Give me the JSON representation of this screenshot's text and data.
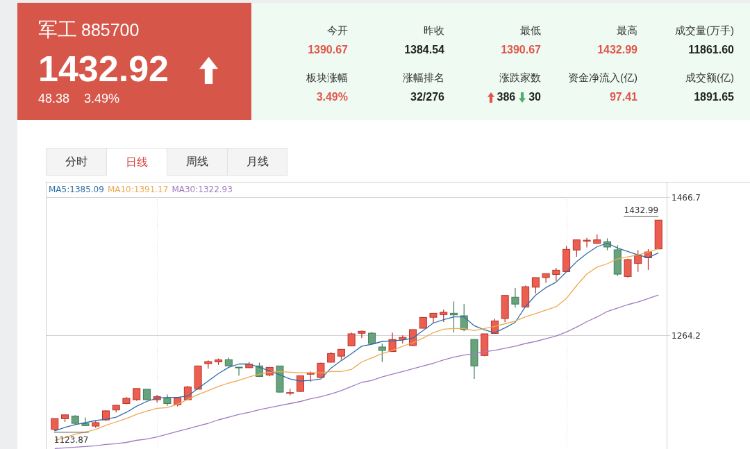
{
  "quote": {
    "name": "军工",
    "code": "885700",
    "price": "1432.92",
    "rising": true,
    "change": "48.38",
    "change_percent": "3.49%"
  },
  "stats": [
    {
      "label": "今开",
      "kind": "value",
      "value": "1390.67",
      "color": "#e0554b"
    },
    {
      "label": "昨收",
      "kind": "value",
      "value": "1384.54",
      "color": "#222222"
    },
    {
      "label": "最低",
      "kind": "value",
      "value": "1390.67",
      "color": "#e0554b"
    },
    {
      "label": "最高",
      "kind": "value",
      "value": "1432.99",
      "color": "#e0554b"
    },
    {
      "label": "成交量(万手)",
      "kind": "value",
      "value": "11861.60",
      "color": "#222222"
    },
    {
      "label": "板块涨幅",
      "kind": "value",
      "value": "3.49%",
      "color": "#e0554b"
    },
    {
      "label": "涨幅排名",
      "kind": "value",
      "value": "32/276",
      "color": "#222222"
    },
    {
      "label": "涨跌家数",
      "kind": "updown",
      "rise_count": "386",
      "fall_count": "30"
    },
    {
      "label": "资金净流入(亿)",
      "kind": "value",
      "value": "97.41",
      "color": "#e0554b"
    },
    {
      "label": "成交额(亿)",
      "kind": "value",
      "value": "1891.65",
      "color": "#222222"
    }
  ],
  "tabs": [
    {
      "label": "分时",
      "selected": false
    },
    {
      "label": "日线",
      "selected": true
    },
    {
      "label": "周线",
      "selected": false
    },
    {
      "label": "月线",
      "selected": false
    }
  ],
  "chart": {
    "chart_data": {
      "type": "candlestick",
      "grid": true,
      "ylim": [
        1097.3,
        1488.1
      ],
      "yticks": [
        {
          "value": 1466.7,
          "label": "1466.7"
        },
        {
          "value": 1264.2,
          "label": "1264.2"
        }
      ],
      "categories": [
        null,
        null,
        null,
        null,
        null,
        null,
        null,
        null,
        null,
        null,
        null,
        null,
        null,
        null,
        null,
        null,
        null,
        null,
        null,
        null,
        null,
        null,
        null,
        null,
        null,
        null,
        null,
        null,
        null,
        null,
        null,
        null,
        null,
        null,
        null,
        null,
        null,
        null,
        null,
        null,
        null,
        null,
        null,
        null,
        null,
        null,
        null,
        null,
        null,
        null,
        null,
        null,
        null,
        null,
        null,
        null,
        null,
        null,
        null,
        null
      ],
      "ohlc": [
        [
          1126,
          1142,
          1123.87,
          1142
        ],
        [
          1141.7,
          1147.4,
          1137,
          1147.4
        ],
        [
          1145.6,
          1147,
          1133,
          1134.9
        ],
        [
          1134.6,
          1143.6,
          1131,
          1131.6
        ],
        [
          1130.9,
          1138.6,
          1128.3,
          1136
        ],
        [
          1140,
          1154,
          1138,
          1153.3
        ],
        [
          1154.6,
          1161.4,
          1151,
          1161.4
        ],
        [
          1164,
          1173.6,
          1162.9,
          1171.6
        ],
        [
          1169.6,
          1186,
          1168,
          1186
        ],
        [
          1184.9,
          1185.5,
          1168.5,
          1169.6
        ],
        [
          1169.6,
          1176.7,
          1165.5,
          1174
        ],
        [
          1171.6,
          1177.3,
          1160.7,
          1164
        ],
        [
          1162.2,
          1172.6,
          1159.6,
          1172.6
        ],
        [
          1169.6,
          1189.8,
          1169,
          1188.2
        ],
        [
          1185,
          1219.1,
          1184.5,
          1219.1
        ],
        [
          1222.5,
          1227.3,
          1215,
          1225.5
        ],
        [
          1225,
          1230,
          1220.5,
          1228
        ],
        [
          1228.3,
          1231.4,
          1219.2,
          1219.2
        ],
        [
          1217.3,
          1217.3,
          1205,
          1217
        ],
        [
          1216.5,
          1225,
          1216,
          1221.5
        ],
        [
          1219.1,
          1224,
          1203,
          1203.7
        ],
        [
          1205.8,
          1217,
          1204,
          1217
        ],
        [
          1219.1,
          1219.1,
          1180,
          1180.7
        ],
        [
          1179,
          1185.5,
          1176,
          1180
        ],
        [
          1181.7,
          1204.6,
          1181,
          1204.6
        ],
        [
          1207,
          1211,
          1196,
          1208.8
        ],
        [
          1202.1,
          1224,
          1201.5,
          1223.1
        ],
        [
          1224.6,
          1239.5,
          1224,
          1237.3
        ],
        [
          1233.5,
          1243.5,
          1228.5,
          1243.5
        ],
        [
          1248.6,
          1268,
          1248,
          1266.2
        ],
        [
          1267,
          1271,
          1260,
          1270
        ],
        [
          1267.2,
          1269,
          1251,
          1252
        ],
        [
          1246.9,
          1252,
          1225,
          1241.8
        ],
        [
          1240.2,
          1268,
          1240,
          1257.9
        ],
        [
          1258,
          1264,
          1252,
          1261
        ],
        [
          1249,
          1272.4,
          1248,
          1272.4
        ],
        [
          1274.4,
          1290.3,
          1274,
          1290.3
        ],
        [
          1290.5,
          1296.4,
          1281.8,
          1296.4
        ],
        [
          1294.4,
          1301.8,
          1283.5,
          1297.8
        ],
        [
          1296.4,
          1313.7,
          1268,
          1294
        ],
        [
          1292.7,
          1309.8,
          1270,
          1272.4
        ],
        [
          1257.9,
          1258,
          1200,
          1219.1
        ],
        [
          1234.4,
          1266.2,
          1233.5,
          1266.2
        ],
        [
          1266.7,
          1288.6,
          1266,
          1285.1
        ],
        [
          1288.6,
          1322.5,
          1283.2,
          1322.5
        ],
        [
          1319.9,
          1333.4,
          1304.6,
          1309.8
        ],
        [
          1305.5,
          1337,
          1305,
          1335.3
        ],
        [
          1334.6,
          1348.7,
          1325.6,
          1348.7
        ],
        [
          1348.7,
          1354.5,
          1341,
          1354.5
        ],
        [
          1353.3,
          1363,
          1343.6,
          1359.5
        ],
        [
          1357.4,
          1395.2,
          1357,
          1390.1
        ],
        [
          1389.1,
          1404,
          1379.2,
          1404
        ],
        [
          1402,
          1407,
          1393,
          1403.5
        ],
        [
          1398.9,
          1412,
          1398,
          1404
        ],
        [
          1401.3,
          1406.2,
          1388.7,
          1393.5
        ],
        [
          1389.4,
          1396.2,
          1351,
          1353.7
        ],
        [
          1350.3,
          1376.5,
          1348.7,
          1375.1
        ],
        [
          1369.4,
          1389,
          1357,
          1381.3
        ],
        [
          1377.7,
          1390.4,
          1360,
          1386.3
        ],
        [
          1390.67,
          1432.99,
          1390.67,
          1432.92
        ]
      ],
      "series": [
        {
          "name": "MA5:1385.09",
          "type": "line",
          "color": "#2f6ea8",
          "values": [
            1124,
            1129,
            1133,
            1136,
            1139,
            1141,
            1144,
            1151,
            1160,
            1167,
            1172,
            1173,
            1173,
            1175,
            1186,
            1197,
            1208,
            1217,
            1222,
            1222,
            1217,
            1212,
            1206,
            1200,
            1197,
            1198,
            1200,
            1216,
            1227,
            1237,
            1248,
            1251,
            1255,
            1256,
            1257,
            1260,
            1271,
            1282,
            1287,
            1291,
            1291,
            1278,
            1272,
            1268,
            1275,
            1283,
            1306,
            1323,
            1334,
            1342,
            1357,
            1372,
            1384,
            1394,
            1399,
            1392,
            1387,
            1382,
            1378,
            1385
          ]
        },
        {
          "name": "MA10:1391.17",
          "type": "line",
          "color": "#eea84f",
          "values": [
            1110,
            1114,
            1119,
            1122,
            1126,
            1132,
            1137,
            1142,
            1148,
            1153,
            1157,
            1158,
            1163,
            1170,
            1177,
            1183,
            1189,
            1194,
            1198,
            1203,
            1207,
            1210,
            1211,
            1210,
            1209,
            1209,
            1209,
            1211,
            1211,
            1214,
            1225,
            1231,
            1237,
            1242,
            1248,
            1253,
            1260,
            1268,
            1273,
            1274,
            1274,
            1271,
            1274,
            1277,
            1281,
            1285,
            1291,
            1296,
            1301,
            1306,
            1318,
            1337,
            1354,
            1364,
            1369,
            1376,
            1379,
            1382,
            1386,
            1391
          ]
        },
        {
          "name": "MA30:1322.93",
          "type": "line",
          "color": "#a07bc0",
          "values": [
            1098,
            1099,
            1100,
            1101,
            1102,
            1104,
            1105,
            1107,
            1110,
            1112,
            1115,
            1119,
            1123,
            1127,
            1131,
            1135,
            1140,
            1144,
            1148,
            1151,
            1155,
            1158,
            1161,
            1164,
            1167,
            1171,
            1174,
            1178,
            1183,
            1189,
            1195,
            1198,
            1203,
            1207,
            1211,
            1215,
            1219,
            1223,
            1228,
            1232,
            1235,
            1237,
            1240,
            1242,
            1245,
            1248,
            1252,
            1255,
            1259,
            1263,
            1269,
            1276,
            1284,
            1291,
            1299,
            1304,
            1309,
            1313,
            1318,
            1323
          ]
        }
      ],
      "annotations": [
        "1432.99",
        "1123.87"
      ]
    }
  }
}
